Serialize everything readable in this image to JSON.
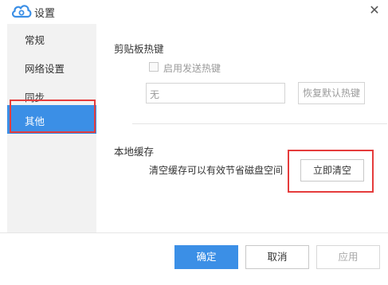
{
  "window": {
    "title": "设置",
    "logo_icon": "cloud-logo-icon",
    "close_icon": "close-icon",
    "close_glyph": "✕"
  },
  "sidebar": {
    "items": [
      {
        "label": "常规",
        "active": false
      },
      {
        "label": "网络设置",
        "active": false
      },
      {
        "label": "同步",
        "active": false
      },
      {
        "label": "其他",
        "active": true
      }
    ]
  },
  "clipboard": {
    "title": "剪贴板热键",
    "enable_checkbox_label": "启用发送热键",
    "enable_checked": false,
    "hotkey_value": "无",
    "restore_default_label": "恢复默认热键"
  },
  "cache": {
    "title": "本地缓存",
    "description": "清空缓存可以有效节省磁盘空间",
    "clear_now_label": "立即清空"
  },
  "footer": {
    "ok_label": "确定",
    "cancel_label": "取消",
    "apply_label": "应用"
  },
  "colors": {
    "accent": "#3b8fe6",
    "highlight": "#e53c3c",
    "sidebar_bg": "#f2f2f2"
  }
}
